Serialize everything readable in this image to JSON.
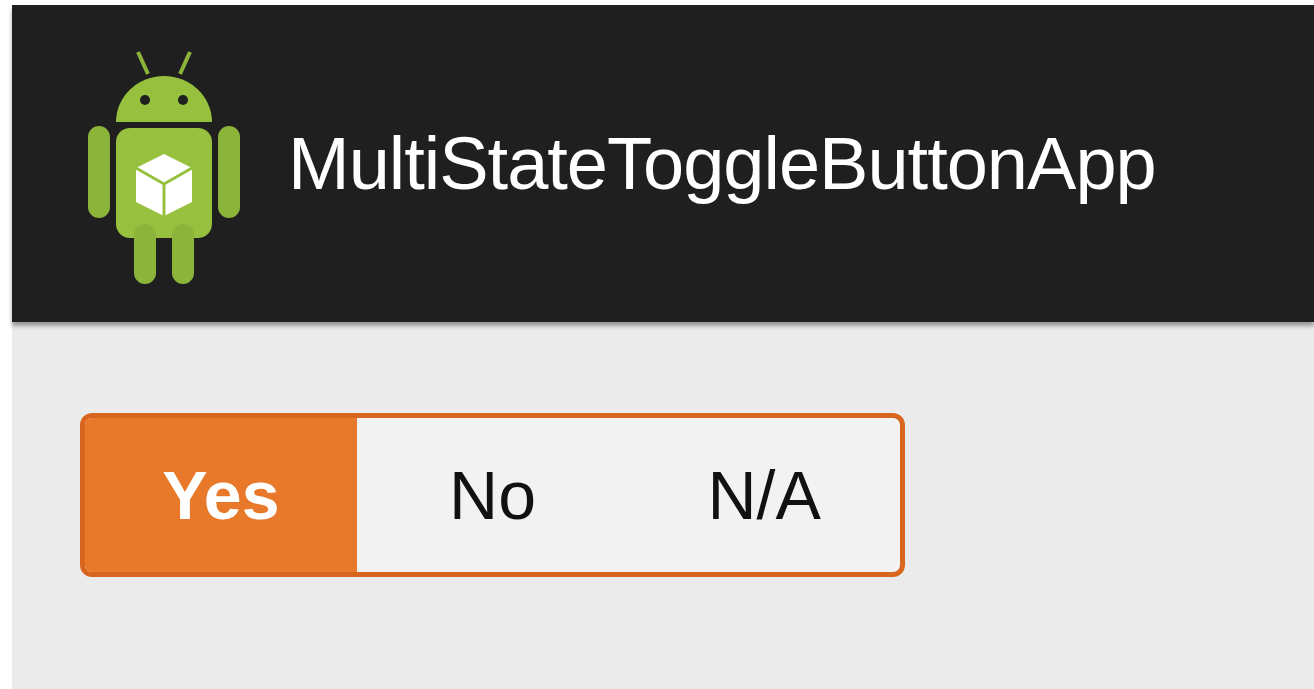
{
  "action_bar": {
    "title": "MultiStateToggleButtonApp"
  },
  "toggle": {
    "options": [
      {
        "label": "Yes",
        "selected": true
      },
      {
        "label": "No",
        "selected": false
      },
      {
        "label": "N/A",
        "selected": false
      }
    ]
  }
}
